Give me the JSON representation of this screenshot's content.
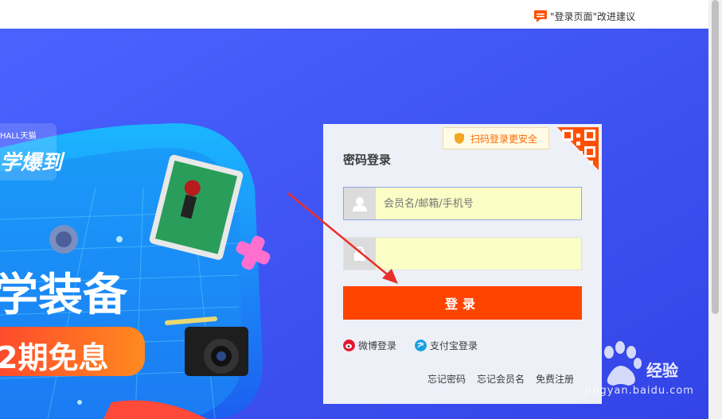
{
  "header": {
    "feedback_label": "\"登录页面\"改进建议",
    "feedback_icon": "comment-icon"
  },
  "banner": {
    "brand_small": "HALL天猫",
    "slogan_partial": "学爆到",
    "headline": "学装备",
    "promo": "2期免息",
    "background_color": "#3d4ff0"
  },
  "login": {
    "qr_tip": "扫码登录更安全",
    "title": "密码登录",
    "username_placeholder": "会员名/邮箱/手机号",
    "password_placeholder": "",
    "submit_label": "登录",
    "weibo_label": "微博登录",
    "alipay_label": "支付宝登录",
    "links": [
      "忘记密码",
      "忘记会员名",
      "免费注册"
    ],
    "accent_color": "#ff4400"
  },
  "watermark": {
    "brand": "经验",
    "url": "jingyan.baidu.com"
  }
}
